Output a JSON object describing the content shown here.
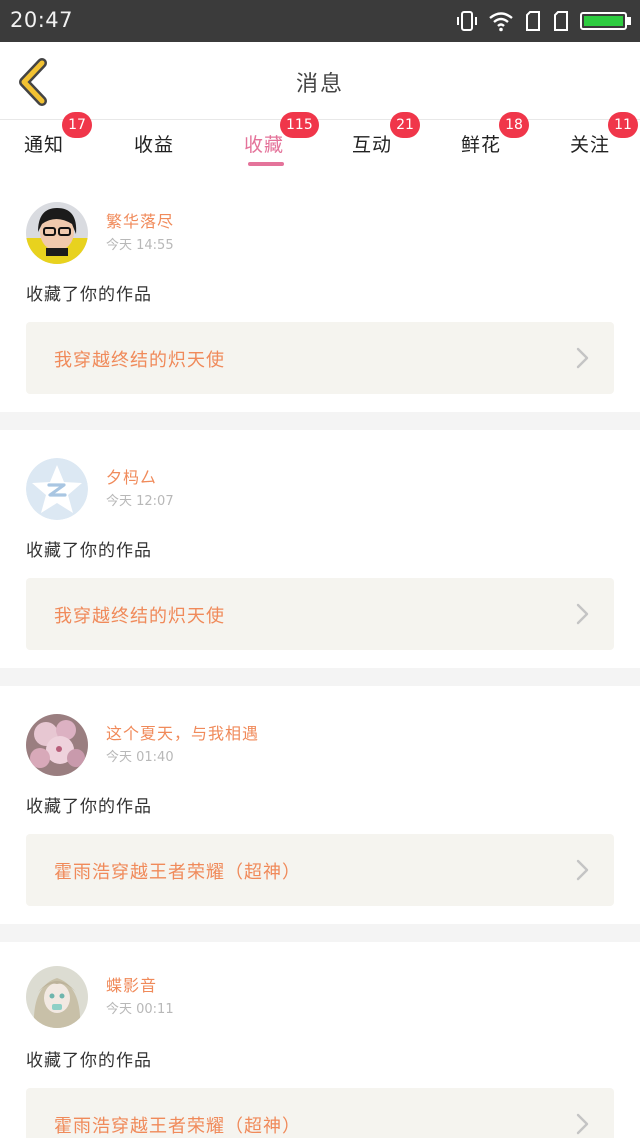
{
  "status_bar": {
    "time": "20:47",
    "icons": [
      "vibrate-icon",
      "wifi-icon",
      "sim-card-icon",
      "sim-card-icon",
      "battery-icon"
    ],
    "battery_color": "#2ecc40"
  },
  "header": {
    "title": "消息",
    "back_icon": "chevron-left-icon",
    "back_color": "#f2c232"
  },
  "tabs": [
    {
      "label": "通知",
      "badge": "17"
    },
    {
      "label": "收益",
      "badge": ""
    },
    {
      "label": "收藏",
      "badge": "115",
      "active": true
    },
    {
      "label": "互动",
      "badge": "21"
    },
    {
      "label": "鲜花",
      "badge": "18"
    },
    {
      "label": "关注",
      "badge": "11"
    }
  ],
  "colors": {
    "accent_pink": "#e4739a",
    "badge_red": "#f0364a",
    "username_orange": "#f08a5a",
    "work_box_bg": "#f5f4ef"
  },
  "feed": [
    {
      "username": "繁华落尽",
      "time": "今天 14:55",
      "action": "收藏了你的作品",
      "work_title": "我穿越终结的炽天使",
      "avatar": "avatar-glasses-person"
    },
    {
      "username": "夕杩厶",
      "time": "今天 12:07",
      "action": "收藏了你的作品",
      "work_title": "我穿越终结的炽天使",
      "avatar": "default-qq-star-avatar"
    },
    {
      "username": "这个夏天，与我相遇",
      "time": "今天 01:40",
      "action": "收藏了你的作品",
      "work_title": "霍雨浩穿越王者荣耀（超神）",
      "avatar": "avatar-pink-blossom"
    },
    {
      "username": "蝶影音",
      "time": "今天 00:11",
      "action": "收藏了你的作品",
      "work_title": "霍雨浩穿越王者荣耀（超神）",
      "avatar": "avatar-anime-girl"
    }
  ]
}
